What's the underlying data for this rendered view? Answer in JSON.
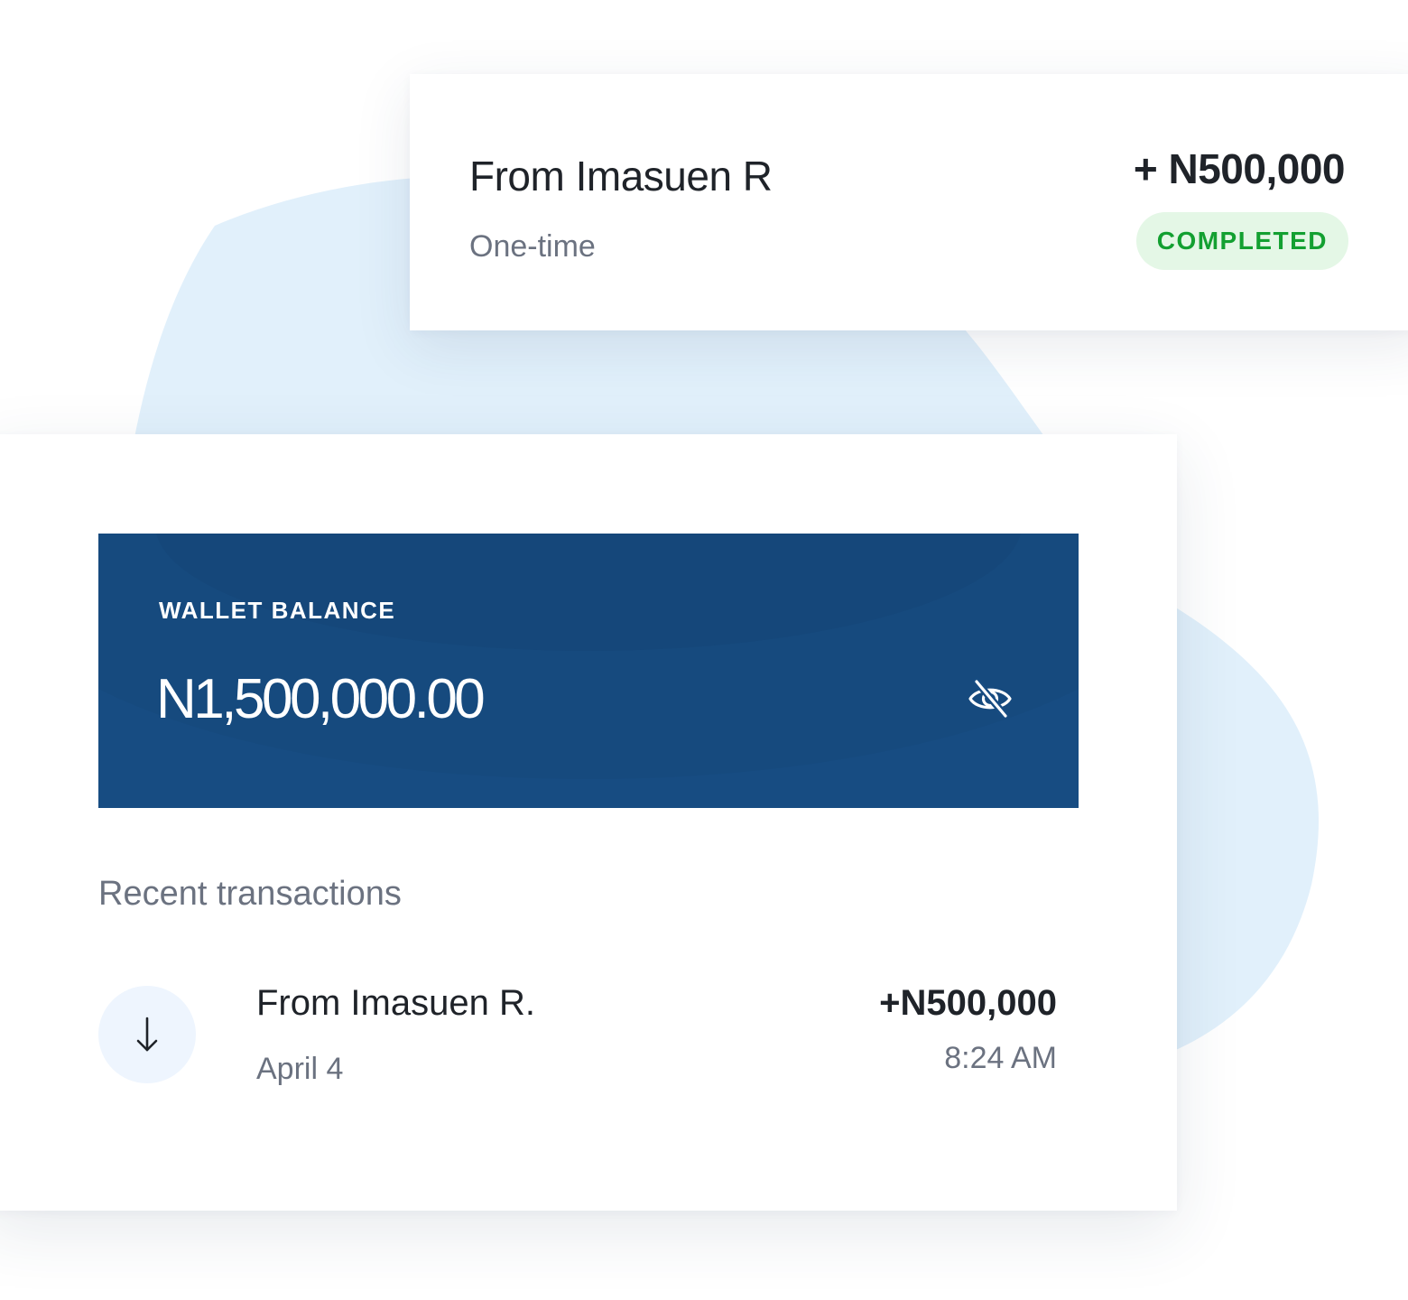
{
  "notification": {
    "title": "From Imasuen R",
    "subtitle": "One-time",
    "amount": "+ N500,000",
    "status": "COMPLETED"
  },
  "wallet": {
    "label": "WALLET BALANCE",
    "balance": "N1,500,000.00",
    "visibility_icon": "eye-off-icon"
  },
  "recent": {
    "heading": "Recent transactions",
    "transactions": [
      {
        "direction_icon": "arrow-down-icon",
        "title": "From Imasuen R.",
        "date": "April 4",
        "amount": "+N500,000",
        "time": "8:24 AM"
      }
    ]
  },
  "colors": {
    "wallet_panel": "#174c82",
    "status_text": "#13a031",
    "status_bg": "#e4f7e6",
    "background_blob": "#e1f0fb",
    "icon_circle": "#eef5fe"
  }
}
